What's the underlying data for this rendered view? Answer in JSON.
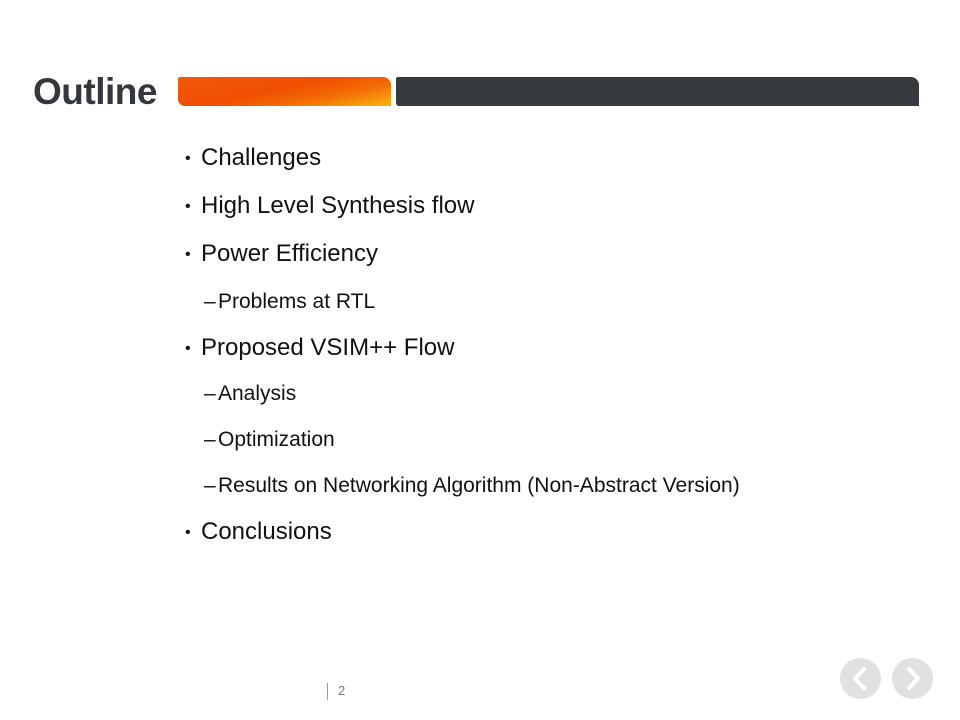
{
  "slide": {
    "title": "Outline",
    "page_number": "2"
  },
  "outline": {
    "items": [
      {
        "bullet": "•",
        "text": "Challenges"
      },
      {
        "bullet": "•",
        "text": "High Level Synthesis flow"
      },
      {
        "bullet": "•",
        "text": "Power Efficiency"
      },
      {
        "bullet": "–",
        "text": "Problems at RTL"
      },
      {
        "bullet": "•",
        "text": "Proposed VSIM++ Flow"
      },
      {
        "bullet": "–",
        "text": "Analysis"
      },
      {
        "bullet": "–",
        "text": "Optimization"
      },
      {
        "bullet": "–",
        "text": "Results on Networking Algorithm (Non-Abstract Version)"
      },
      {
        "bullet": "•",
        "text": "Conclusions"
      }
    ]
  },
  "navigation": {
    "prev_icon": "chevron-left-icon",
    "next_icon": "chevron-right-icon"
  },
  "colors": {
    "title": "#34373b",
    "accent_orange": "#f04e00",
    "accent_dark": "#363a3e",
    "nav_button": "#e1e1e1"
  }
}
